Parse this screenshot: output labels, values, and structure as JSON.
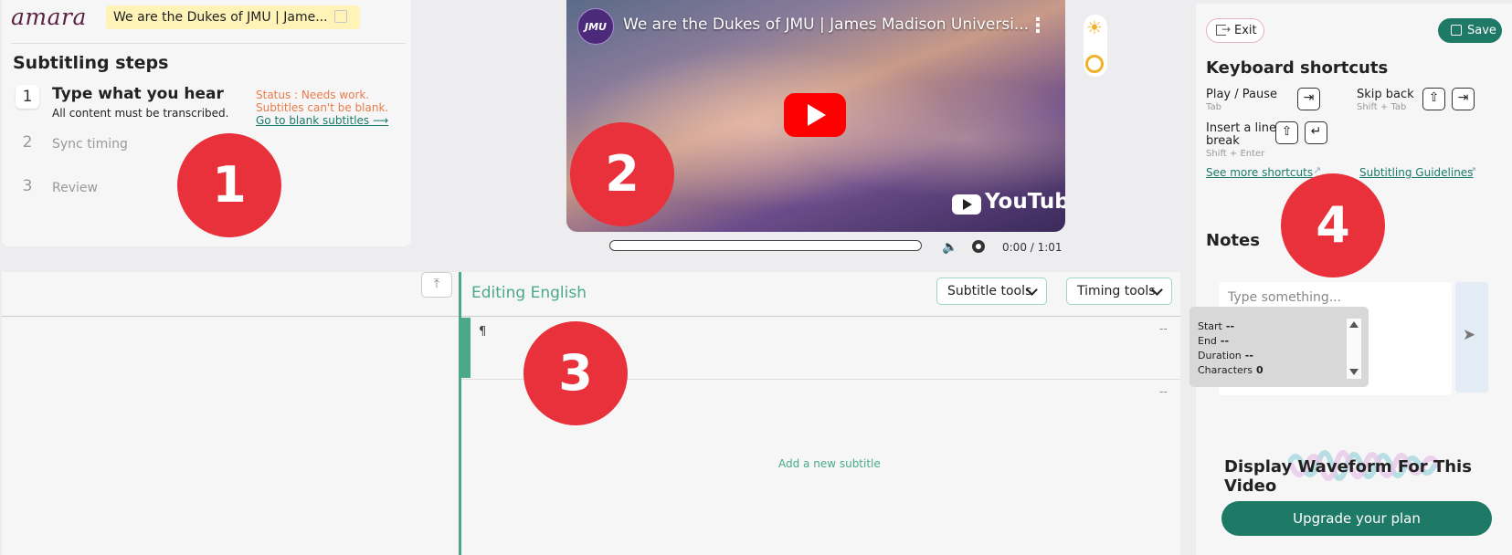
{
  "app": {
    "logo": "amara",
    "video_title_field": "We are the Dukes of JMU | Jame..."
  },
  "steps": {
    "heading": "Subtitling steps",
    "items": [
      {
        "num": "1",
        "label": "Type what you hear",
        "sub": "All content must be transcribed."
      },
      {
        "num": "2",
        "label": "Sync timing"
      },
      {
        "num": "3",
        "label": "Review"
      }
    ],
    "status_line1": "Status : Needs work.",
    "status_line2": "Subtitles can't be blank.",
    "blank_link": "Go to blank subtitles ⟶"
  },
  "video": {
    "channel_logo": "JMU",
    "title": "We are the Dukes of JMU | James Madison Universi...",
    "kebab": "⋮",
    "yt_text": "YouTube",
    "time": "0:00 / 1:01",
    "progress": 0
  },
  "badges": {
    "b1": "1",
    "b2": "2",
    "b3": "3",
    "b4": "4"
  },
  "editor": {
    "upload_icon": "⤒",
    "editing_label": "Editing English",
    "subtitle_tools": "Subtitle tools",
    "timing_tools": "Timing tools",
    "pilcrow": "¶",
    "row1_dash": "--",
    "row2_dash": "--",
    "add_subtitle": "Add a new subtitle"
  },
  "side": {
    "exit": "Exit",
    "save": "Save",
    "shortcuts_heading": "Keyboard shortcuts",
    "play_pause": "Play / Pause",
    "play_hint": "Tab",
    "skip_back": "Skip back",
    "skip_hint": "Shift + Tab",
    "line_break_1": "Insert a line",
    "line_break_2": "break",
    "line_break_hint": "Shift + Enter",
    "keys": {
      "tab": "⇥",
      "shift": "⇧",
      "enter": "↵"
    },
    "more_shortcuts": "See more shortcuts",
    "guidelines": "Subtitling Guidelines",
    "external_icon": "↗",
    "notes_heading": "Notes",
    "notes_placeholder": "Type something...",
    "send_icon": "➤",
    "timing_info": {
      "start_label": "Start",
      "start_val": "--",
      "end_label": "End",
      "end_val": "--",
      "duration_label": "Duration",
      "duration_val": "--",
      "chars_label": "Characters",
      "chars_val": "0"
    },
    "waveform_heading": "Display Waveform For This Video",
    "upgrade": "Upgrade your plan"
  },
  "colors": {
    "accent": "#1e7a66",
    "teal": "#4aa98a",
    "badge": "#e8313a",
    "status": "#e87c4a",
    "brand": "#5a2441"
  }
}
